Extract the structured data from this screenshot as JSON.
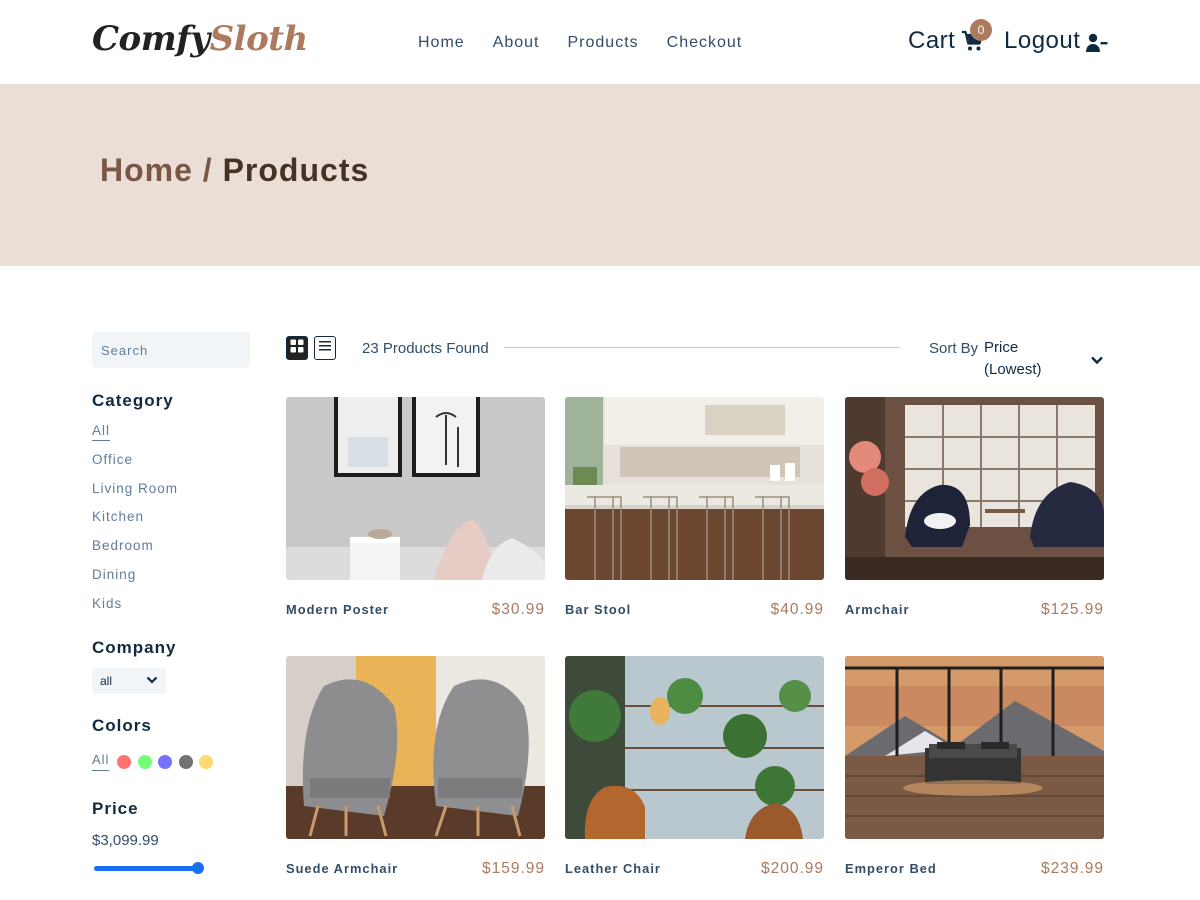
{
  "header": {
    "logo_part1": "Comfy",
    "logo_part2": "Sloth",
    "nav": [
      "Home",
      "About",
      "Products",
      "Checkout"
    ],
    "cart_label": "Cart",
    "cart_count": "0",
    "logout_label": "Logout"
  },
  "hero": {
    "crumb_home": "Home /",
    "crumb_current": "Products"
  },
  "filters": {
    "search_placeholder": "Search",
    "category_heading": "Category",
    "categories": [
      "All",
      "Office",
      "Living Room",
      "Kitchen",
      "Bedroom",
      "Dining",
      "Kids"
    ],
    "active_category": "All",
    "company_heading": "Company",
    "company_selected": "all",
    "colors_heading": "Colors",
    "colors_all": "All",
    "colors": [
      "#ff0000",
      "#00ff00",
      "#0000ff",
      "#000000",
      "#ffb900"
    ],
    "price_heading": "Price",
    "price_value": "$3,099.99",
    "price_slider_fraction": 1.0
  },
  "sort": {
    "found_text": "23 Products Found",
    "sort_label": "Sort By",
    "sort_selected": "Price (Lowest)",
    "view_mode": "grid"
  },
  "products": [
    {
      "name": "Modern Poster",
      "price": "$30.99"
    },
    {
      "name": "Bar Stool",
      "price": "$40.99"
    },
    {
      "name": "Armchair",
      "price": "$125.99"
    },
    {
      "name": "Suede Armchair",
      "price": "$159.99"
    },
    {
      "name": "Leather Chair",
      "price": "$200.99"
    },
    {
      "name": "Emperor Bed",
      "price": "$239.99"
    }
  ],
  "colors": {
    "brand": "#ab7a5f",
    "hero_bg": "#eaded7",
    "text": "#324d67",
    "slider": "#1a6ff1"
  }
}
